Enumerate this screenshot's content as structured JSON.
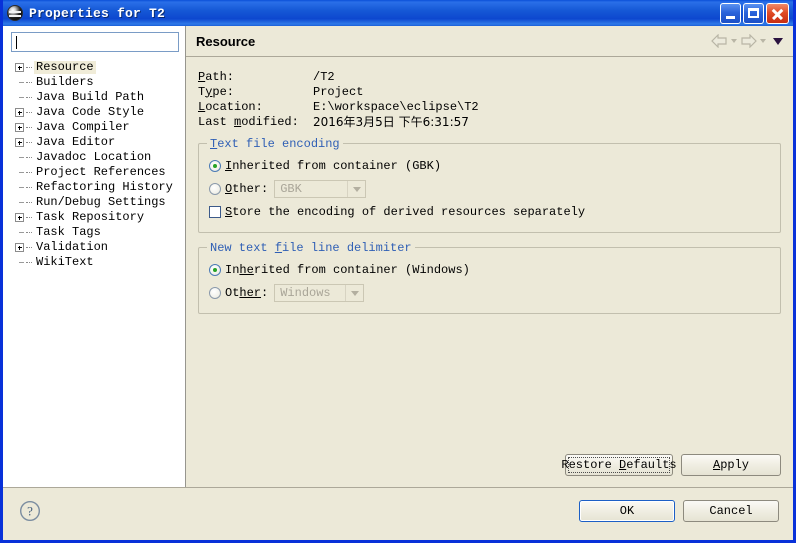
{
  "window": {
    "title": "Properties for T2",
    "icon": "eclipse-properties-icon",
    "buttons": {
      "minimize": "minimize-button",
      "maximize": "maximize-button",
      "close": "close-button"
    }
  },
  "sidebar": {
    "filter": {
      "value": "",
      "placeholder": ""
    },
    "items": [
      {
        "label": "Resource",
        "expandable": true,
        "selected": true
      },
      {
        "label": "Builders",
        "expandable": false,
        "selected": false
      },
      {
        "label": "Java Build Path",
        "expandable": false,
        "selected": false
      },
      {
        "label": "Java Code Style",
        "expandable": true,
        "selected": false
      },
      {
        "label": "Java Compiler",
        "expandable": true,
        "selected": false
      },
      {
        "label": "Java Editor",
        "expandable": true,
        "selected": false
      },
      {
        "label": "Javadoc Location",
        "expandable": false,
        "selected": false
      },
      {
        "label": "Project References",
        "expandable": false,
        "selected": false
      },
      {
        "label": "Refactoring History",
        "expandable": false,
        "selected": false
      },
      {
        "label": "Run/Debug Settings",
        "expandable": false,
        "selected": false
      },
      {
        "label": "Task Repository",
        "expandable": true,
        "selected": false
      },
      {
        "label": "Task Tags",
        "expandable": false,
        "selected": false
      },
      {
        "label": "Validation",
        "expandable": true,
        "selected": false
      },
      {
        "label": "WikiText",
        "expandable": false,
        "selected": false
      }
    ]
  },
  "page": {
    "title": "Resource",
    "nav": {
      "back_icon": "back-arrow-icon",
      "forward_icon": "forward-arrow-icon",
      "menu_icon": "chevron-down-icon"
    },
    "info": [
      {
        "label": "Path:",
        "mnemonic": "P",
        "value": "/T2"
      },
      {
        "label": "Type:",
        "mnemonic": "y",
        "value": "Project"
      },
      {
        "label": "Location:",
        "mnemonic": "L",
        "value": "E:\\workspace\\eclipse\\T2"
      },
      {
        "label": "Last modified:",
        "mnemonic": "m",
        "value": "2016年3月5日 下午6:31:57"
      }
    ],
    "encoding_group": {
      "title": "Text file encoding",
      "inherited_label": "Inherited from container  (GBK)",
      "inherited_selected": true,
      "other_label": "Other:",
      "other_selected": false,
      "other_value": "GBK",
      "store_checkbox_label": "Store the encoding of derived resources separately",
      "store_checked": false
    },
    "delimiter_group": {
      "title": "New text file line delimiter",
      "inherited_label": "Inherited from container  (Windows)",
      "inherited_selected": true,
      "other_label": "Other:",
      "other_selected": false,
      "other_value": "Windows"
    },
    "restore_defaults_label": "Restore Defaults",
    "apply_label": "Apply"
  },
  "footer": {
    "help_icon": "help-question-icon",
    "ok_label": "OK",
    "cancel_label": "Cancel"
  },
  "colors": {
    "titlebar_blue": "#0b50d8",
    "window_border": "#0831d9",
    "dialog_bg": "#ece9d8",
    "group_title": "#2f5fb5",
    "radio_dot_green": "#27a327",
    "tree_selection": "#f0ecd8"
  }
}
